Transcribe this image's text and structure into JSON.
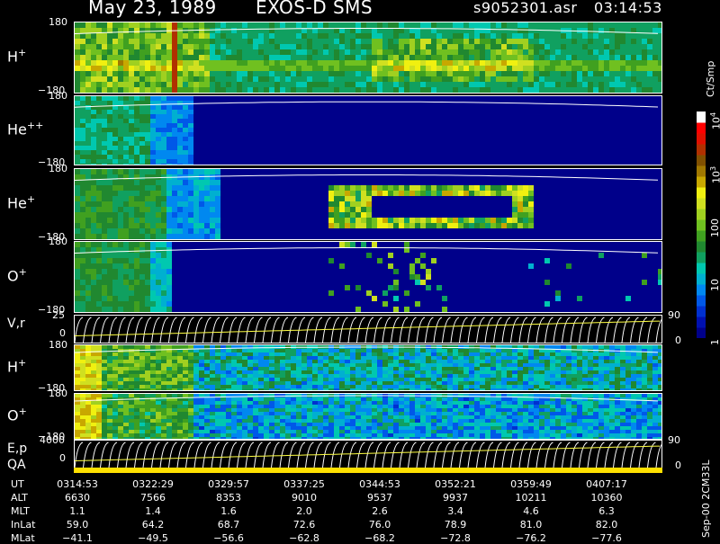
{
  "header": {
    "date": "May 23, 1989",
    "instrument": "EXOS-D SMS",
    "file": "s9052301.asr",
    "time": "03:14:53"
  },
  "chart_data": {
    "type": "heatmap",
    "panels": [
      {
        "id": "H+",
        "label": "H",
        "sup": "+",
        "ymax": "180",
        "ymin": "−180",
        "ylim": [
          -180,
          180
        ]
      },
      {
        "id": "He++",
        "label": "He",
        "sup": "++",
        "ymax": "180",
        "ymin": "−180",
        "ylim": [
          -180,
          180
        ]
      },
      {
        "id": "He+",
        "label": "He",
        "sup": "+",
        "ymax": "180",
        "ymin": "−180",
        "ylim": [
          -180,
          180
        ]
      },
      {
        "id": "O+",
        "label": "O",
        "sup": "+",
        "ymax": "180",
        "ymin": "−180",
        "ylim": [
          -180,
          180
        ]
      },
      {
        "id": "H+ (lower)",
        "label": "H",
        "sup": "+",
        "ymax": "180",
        "ymin": "−180",
        "ylim": [
          -180,
          180
        ]
      },
      {
        "id": "O+ (lower)",
        "label": "O",
        "sup": "+",
        "ymax": "180",
        "ymin": "−180",
        "ylim": [
          -180,
          180
        ]
      }
    ],
    "line_panels": [
      {
        "id": "V,r",
        "label": "V,r",
        "ymax": "25",
        "ymin": "0",
        "rmax": "90",
        "rmin": "0"
      },
      {
        "id": "E,p",
        "label": "E,p",
        "label2": "QA",
        "ymax": "4000",
        "ymin": "0",
        "rmax": "90",
        "rmin": "0"
      }
    ],
    "colorbar": {
      "unit": "Ct/Smp",
      "ticks": [
        {
          "label": "1",
          "value": 1
        },
        {
          "label": "10",
          "value": 10
        },
        {
          "label": "100",
          "value": 100
        },
        {
          "label": "10",
          "sup": "3",
          "value": 1000
        },
        {
          "label": "10",
          "sup": "4",
          "value": 10000
        }
      ],
      "colors": [
        "#00008a",
        "#0010b0",
        "#0030d0",
        "#0058e8",
        "#0088f0",
        "#00b0d0",
        "#00c8b0",
        "#10a060",
        "#208830",
        "#40a020",
        "#70c020",
        "#a0d020",
        "#d0e020",
        "#f0f010",
        "#c8a800",
        "#a07800",
        "#805000",
        "#b03000",
        "#e01000",
        "#ff0000",
        "#ffffff"
      ]
    },
    "x_axis": {
      "rows": [
        {
          "name": "UT",
          "values": [
            "0314:53",
            "0322:29",
            "0329:57",
            "0337:25",
            "0344:53",
            "0352:21",
            "0359:49",
            "0407:17"
          ]
        },
        {
          "name": "ALT",
          "values": [
            "6630",
            "7566",
            "8353",
            "9010",
            "9537",
            "9937",
            "10211",
            "10360"
          ]
        },
        {
          "name": "MLT",
          "values": [
            "1.1",
            "1.4",
            "1.6",
            "2.0",
            "2.6",
            "3.4",
            "4.6",
            "6.3"
          ]
        },
        {
          "name": "InLat",
          "values": [
            "59.0",
            "64.2",
            "68.7",
            "72.6",
            "76.0",
            "78.9",
            "81.0",
            "82.0"
          ]
        },
        {
          "name": "MLat",
          "values": [
            "−41.1",
            "−49.5",
            "−56.6",
            "−62.8",
            "−68.2",
            "−72.8",
            "−76.2",
            "−77.6"
          ]
        }
      ]
    }
  },
  "footer": {
    "stamp": "Sep-00 2CM33L"
  }
}
